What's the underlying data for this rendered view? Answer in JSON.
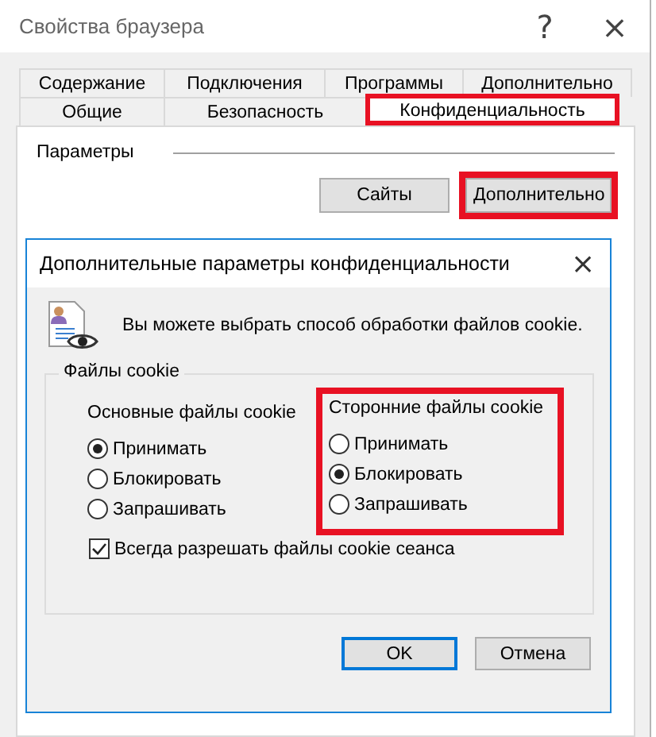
{
  "window": {
    "title": "Свойства браузера",
    "help": "?",
    "close": "×"
  },
  "tabs_row_1": [
    {
      "label": "Содержание",
      "selected": false
    },
    {
      "label": "Подключения",
      "selected": false
    },
    {
      "label": "Программы",
      "selected": false
    },
    {
      "label": "Дополнительно",
      "selected": false
    }
  ],
  "tabs_row_2": [
    {
      "label": "Общие",
      "selected": false,
      "highlighted": false
    },
    {
      "label": "Безопасность",
      "selected": false,
      "highlighted": false
    },
    {
      "label": "Конфиденциальность",
      "selected": true,
      "highlighted": true
    }
  ],
  "parameters": {
    "title": "Параметры",
    "buttons": [
      {
        "label": "Сайты",
        "highlighted": false
      },
      {
        "label": "Дополнительно",
        "highlighted": true
      }
    ]
  },
  "dialog": {
    "title": "Дополнительные параметры конфиденциальности",
    "close": "×",
    "intro": "Вы можете выбрать способ обработки файлов cookie.",
    "group": {
      "title": "Файлы cookie",
      "columns": [
        {
          "title": "Основные файлы cookie",
          "highlighted": false,
          "options": [
            {
              "label": "Принимать",
              "selected": true
            },
            {
              "label": "Блокировать",
              "selected": false
            },
            {
              "label": "Запрашивать",
              "selected": false
            }
          ]
        },
        {
          "title": "Сторонние файлы cookie",
          "highlighted": true,
          "options": [
            {
              "label": "Принимать",
              "selected": false
            },
            {
              "label": "Блокировать",
              "selected": true
            },
            {
              "label": "Запрашивать",
              "selected": false
            }
          ]
        }
      ],
      "checkbox": {
        "label": "Всегда разрешать файлы cookie сеанса",
        "checked": true
      }
    },
    "buttons": [
      {
        "label": "OK",
        "default": true
      },
      {
        "label": "Отмена",
        "default": false
      }
    ]
  }
}
